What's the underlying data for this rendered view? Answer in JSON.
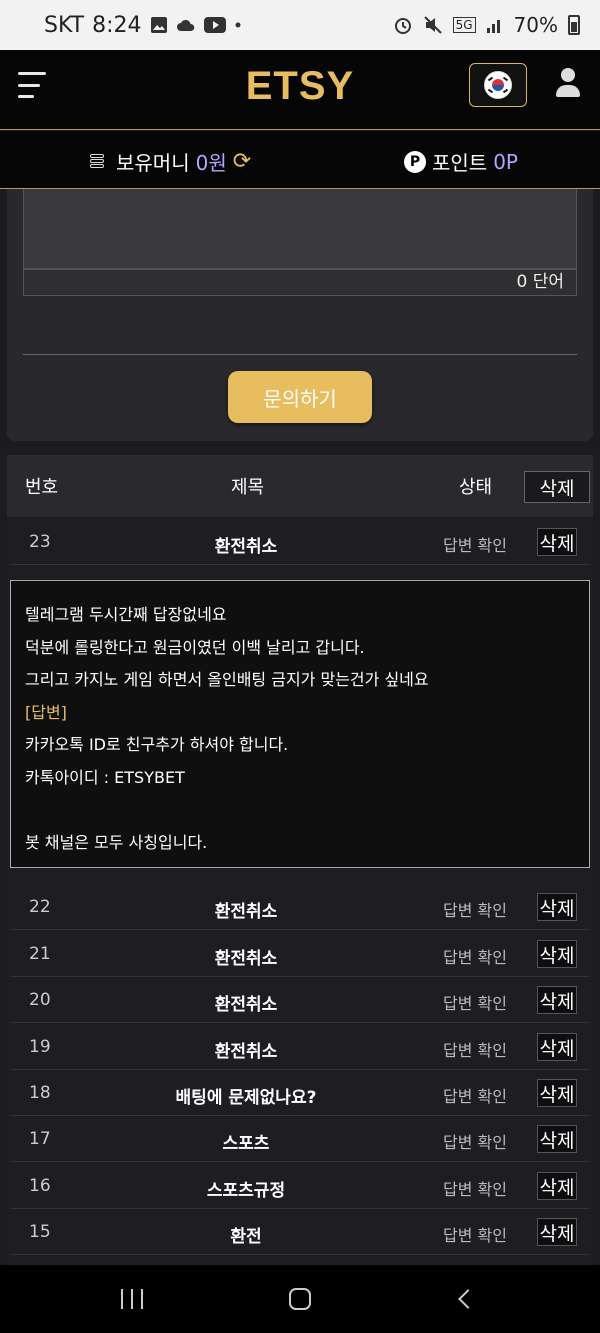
{
  "status_bar": {
    "carrier": "SKT",
    "time": "8:24",
    "network": "5G",
    "battery": "70%"
  },
  "header": {
    "logo": "ETSY"
  },
  "wallet": {
    "money_label": "보유머니",
    "money_value": "0원",
    "points_badge": "P",
    "points_label": "포인트",
    "points_value": "0P"
  },
  "form": {
    "word_count": "0 단어",
    "submit_label": "문의하기"
  },
  "table": {
    "headers": {
      "no": "번호",
      "title": "제목",
      "status": "상태",
      "delete": "삭제"
    },
    "rows": [
      {
        "no": "23",
        "title": "환전취소",
        "status": "답변 확인",
        "delete": "삭제"
      },
      {
        "no": "22",
        "title": "환전취소",
        "status": "답변 확인",
        "delete": "삭제"
      },
      {
        "no": "21",
        "title": "환전취소",
        "status": "답변 확인",
        "delete": "삭제"
      },
      {
        "no": "20",
        "title": "환전취소",
        "status": "답변 확인",
        "delete": "삭제"
      },
      {
        "no": "19",
        "title": "환전취소",
        "status": "답변 확인",
        "delete": "삭제"
      },
      {
        "no": "18",
        "title": "배팅에 문제없나요?",
        "status": "답변 확인",
        "delete": "삭제"
      },
      {
        "no": "17",
        "title": "스포츠",
        "status": "답변 확인",
        "delete": "삭제"
      },
      {
        "no": "16",
        "title": "스포츠규정",
        "status": "답변 확인",
        "delete": "삭제"
      },
      {
        "no": "15",
        "title": "환전",
        "status": "답변 확인",
        "delete": "삭제"
      }
    ],
    "expanded": {
      "lines": [
        "텔레그램 두시간째 답장없네요",
        "덕분에 롤링한다고 원금이였던 이백 날리고 갑니다.",
        "그리고 카지노 게임 하면서 올인배팅 금지가 맞는건가 싶네요"
      ],
      "answer_tag": "[답변]",
      "answer_lines": [
        "카카오톡 ID로 친구추가 하셔야 합니다.",
        "카톡아이디 : ETSYBET",
        "",
        "봇 채널은 모두 사칭입니다."
      ]
    }
  },
  "colors": {
    "accent_gold": "#e8bd62",
    "value_violet": "#b8a3ff",
    "background": "#1c1c1f"
  },
  "icons": [
    "menu-icon",
    "korea-flag-icon",
    "user-icon",
    "coins-icon",
    "refresh-icon",
    "point-icon"
  ]
}
